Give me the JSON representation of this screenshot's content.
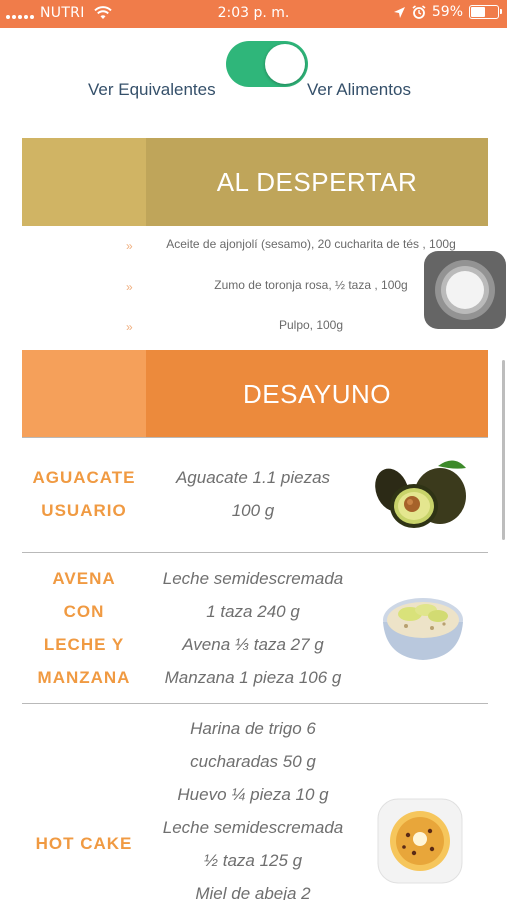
{
  "status_bar": {
    "carrier": "NUTRI",
    "time": "2:03 p. m.",
    "battery_label": "59%",
    "battery_level": 0.59,
    "icons": [
      "signal-dots-icon",
      "wifi-icon",
      "location-arrow-icon",
      "alarm-clock-icon",
      "battery-icon"
    ]
  },
  "toggle": {
    "left_label": "Ver Equivalentes",
    "right_label": "Ver Alimentos",
    "state": "on",
    "color": "#2fb67a"
  },
  "sections": [
    {
      "title": "AL DESPERTAR",
      "colors": {
        "stripe": "#d0b464",
        "main": "#bfa55a"
      },
      "items": [
        {
          "bullet": "»",
          "text": "Aceite de ajonjolí (sesamo), 20 cucharita de tés , 100g"
        },
        {
          "bullet": "»",
          "text": "Zumo de toronja rosa, ½ taza , 100g"
        },
        {
          "bullet": "»",
          "text": "Pulpo, 100g"
        }
      ]
    },
    {
      "title": "DESAYUNO",
      "colors": {
        "stripe": "#f5a05a",
        "main": "#ec8a3c"
      },
      "meals": [
        {
          "name_lines": [
            "AGUACATE",
            "USUARIO"
          ],
          "desc_lines": [
            "Aguacate 1.1 piezas",
            "100 g"
          ],
          "image": "avocado-image"
        },
        {
          "name_lines": [
            "AVENA",
            "CON",
            "LECHE Y",
            "MANZANA"
          ],
          "desc_lines": [
            "Leche semidescremada",
            "1 taza 240 g",
            "Avena ⅓ taza 27 g",
            "Manzana 1 pieza 106 g"
          ],
          "image": "oatmeal-bowl-image"
        },
        {
          "name_lines": [
            "HOT CAKE"
          ],
          "desc_lines": [
            "Harina de trigo 6",
            "cucharadas 50 g",
            "Huevo ¼ pieza 10 g",
            "Leche semidescremada",
            "½ taza 125 g",
            "Miel de abeja 2"
          ],
          "image": "hotcake-plate-image"
        }
      ]
    }
  ],
  "accent_colors": {
    "status_bar": "#f07c4a",
    "meal_name": "#f09a42",
    "label": "#35506a"
  }
}
